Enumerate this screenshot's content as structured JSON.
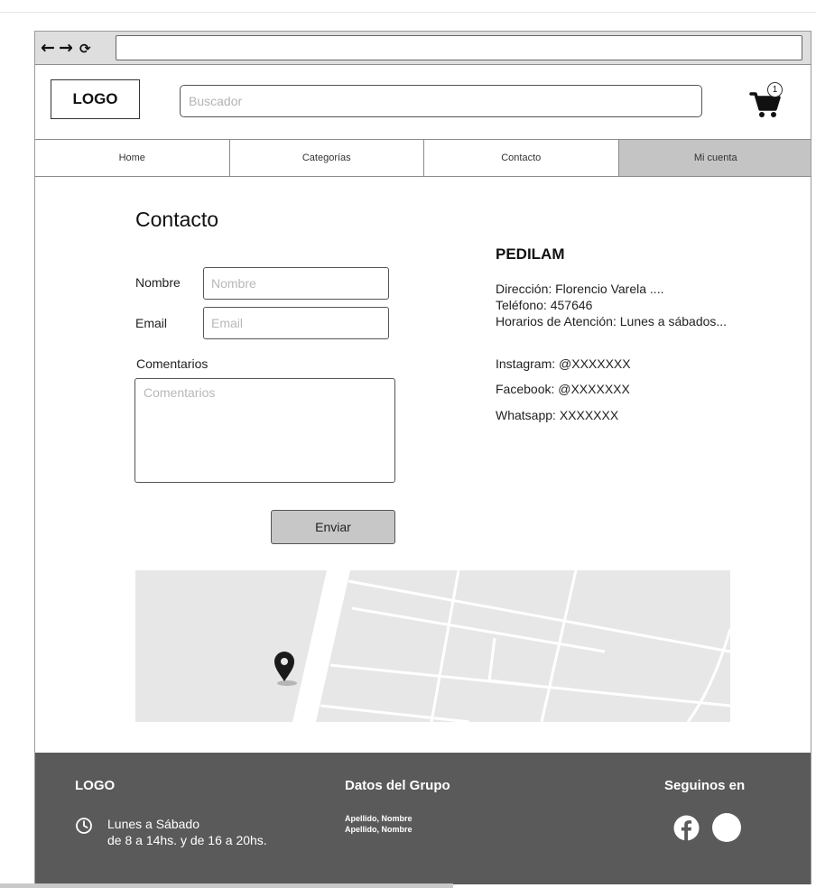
{
  "colors": {
    "tab_active": "#c4c4c4",
    "footer_bg": "#5a5a5a",
    "button_bg": "#c7c7c7",
    "map_bg": "#e7e7e7"
  },
  "browser": {
    "back_icon": "←",
    "forward_icon": "→",
    "reload_icon": "⟳",
    "url": ""
  },
  "header": {
    "logo": "LOGO",
    "search_placeholder": "Buscador",
    "cart_count": "1"
  },
  "nav": {
    "tabs": [
      {
        "label": "Home"
      },
      {
        "label": "Categorías"
      },
      {
        "label": "Contacto"
      },
      {
        "label": "Mi cuenta"
      }
    ]
  },
  "contact": {
    "title": "Contacto",
    "name_label": "Nombre",
    "name_placeholder": "Nombre",
    "email_label": "Email",
    "email_placeholder": "Email",
    "comments_label": "Comentarios",
    "comments_placeholder": "Comentarios",
    "submit_label": "Enviar"
  },
  "info": {
    "title": "PEDILAM",
    "address": "Dirección: Florencio Varela ....",
    "phone": "Teléfono: 457646",
    "hours": "Horarios de Atención: Lunes a sábados...",
    "instagram": "Instagram: @XXXXXXX",
    "facebook": "Facebook: @XXXXXXX",
    "whatsapp": "Whatsapp: XXXXXXX"
  },
  "map": {
    "pin_icon": "map-pin-icon"
  },
  "footer": {
    "logo": "LOGO",
    "hours_line1": "Lunes a Sábado",
    "hours_line2": "de 8 a 14hs. y de 16 a 20hs.",
    "group_title": "Datos del Grupo",
    "group_members": [
      "Apellido, Nombre",
      "Apellido, Nombre"
    ],
    "follow_title": "Seguinos en"
  }
}
